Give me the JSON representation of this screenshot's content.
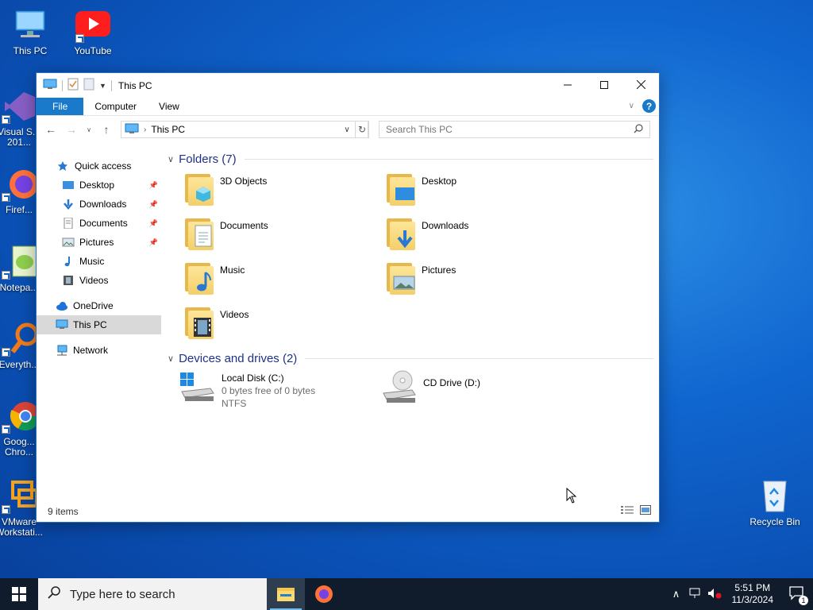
{
  "desktop": {
    "icons": [
      {
        "label": "This PC"
      },
      {
        "label": "YouTube"
      },
      {
        "label": "Visual S... 201..."
      },
      {
        "label": "Firef..."
      },
      {
        "label": "Notepa..."
      },
      {
        "label": "Everyth..."
      },
      {
        "label": "Goog... Chro..."
      },
      {
        "label": "VMware Workstati..."
      }
    ],
    "recycle_bin": "Recycle Bin"
  },
  "window": {
    "title": "This PC",
    "ribbon_tabs": [
      "File",
      "Computer",
      "View"
    ],
    "help": "?",
    "address": {
      "location": "This PC"
    },
    "search_placeholder": "Search This PC",
    "status": "9 items"
  },
  "nav_pane": {
    "quick_access": "Quick access",
    "quick_items": [
      "Desktop",
      "Downloads",
      "Documents",
      "Pictures",
      "Music",
      "Videos"
    ],
    "onedrive": "OneDrive",
    "this_pc": "This PC",
    "network": "Network"
  },
  "content": {
    "folders_header": "Folders (7)",
    "folders": [
      "3D Objects",
      "Desktop",
      "Documents",
      "Downloads",
      "Music",
      "Pictures",
      "Videos"
    ],
    "devices_header": "Devices and drives (2)",
    "drives": [
      {
        "name": "Local Disk (C:)",
        "space": "0 bytes free of 0 bytes",
        "fs": "NTFS"
      },
      {
        "name": "CD Drive (D:)"
      }
    ]
  },
  "taskbar": {
    "search_placeholder": "Type here to search",
    "time": "5:51 PM",
    "date": "11/3/2024",
    "notification_count": "1"
  },
  "colors": {
    "accent": "#1979ca",
    "taskbar": "#101c2c",
    "folder": "#f4cf6a"
  }
}
